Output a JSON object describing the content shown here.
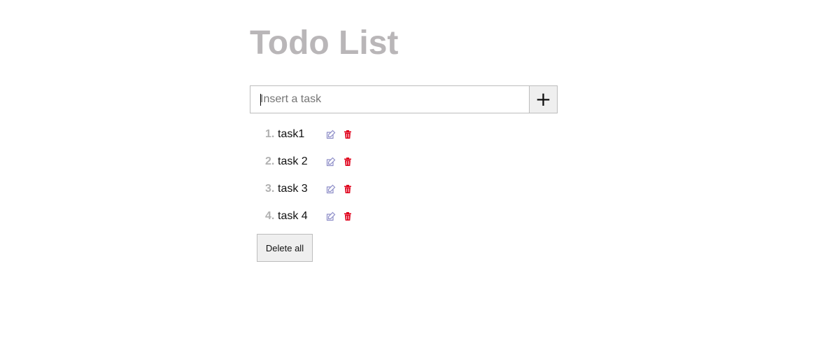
{
  "header": {
    "title": "Todo List"
  },
  "add_form": {
    "input_value": "",
    "input_placeholder": "Insert a task",
    "add_button_label": "+"
  },
  "tasks": [
    {
      "number": "1.",
      "text": "task1"
    },
    {
      "number": "2.",
      "text": "task 2"
    },
    {
      "number": "3.",
      "text": "task 3"
    },
    {
      "number": "4.",
      "text": "task 4"
    }
  ],
  "actions": {
    "delete_all_label": "Delete all"
  },
  "icons": {
    "edit": "edit-icon",
    "delete": "trash-icon"
  },
  "colors": {
    "title": "#b9b6b8",
    "edit_icon": "#8e8ec8",
    "delete_icon": "#e0001b"
  }
}
